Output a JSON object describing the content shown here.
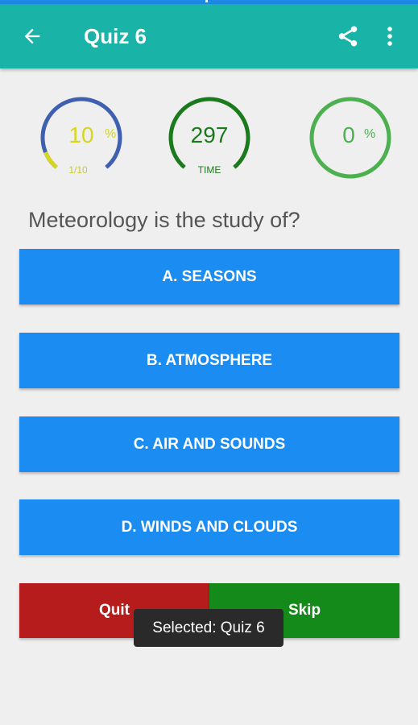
{
  "appbar": {
    "title": "Quiz 6",
    "back_icon": "arrow-back-icon",
    "share_icon": "share-icon",
    "more_icon": "more-vert-icon",
    "color": "#1ab3a8"
  },
  "score_gauge": {
    "value": "10",
    "suffix": "%",
    "sub": "1/10",
    "progress": 0.1,
    "track_color": "#3f5fb0",
    "fill_color": "#d6d61f"
  },
  "time_gauge": {
    "value": "297",
    "sub": "TIME",
    "color": "#1b7a1b"
  },
  "accuracy_gauge": {
    "value": "0",
    "suffix": "%",
    "color": "#4caf50"
  },
  "question": "Meteorology is the study of?",
  "options": [
    {
      "label": "A. SEASONS"
    },
    {
      "label": "B. ATMOSPHERE"
    },
    {
      "label": "C. AIR AND SOUNDS"
    },
    {
      "label": "D. WINDS AND CLOUDS"
    }
  ],
  "actions": {
    "quit": "Quit",
    "skip": "Skip"
  },
  "toast": "Selected: Quiz 6",
  "colors": {
    "option": "#1a8cf2",
    "quit": "#b71c1c",
    "skip": "#138a1a",
    "background": "#efefef"
  }
}
